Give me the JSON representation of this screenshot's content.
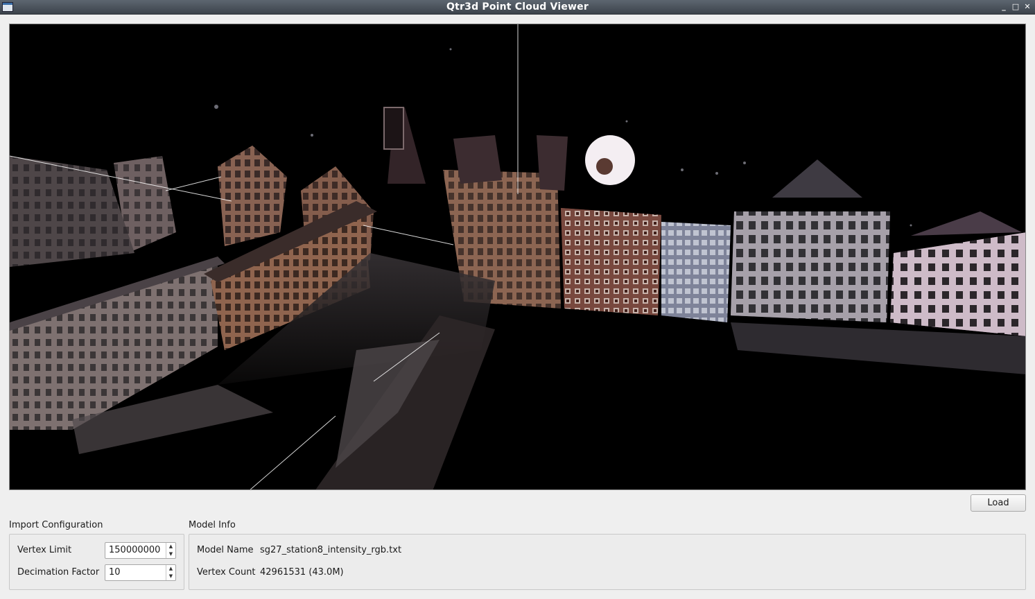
{
  "window": {
    "title": "Qtr3d Point Cloud Viewer",
    "controls": {
      "minimize": "_",
      "maximize": "□",
      "close": "✕"
    }
  },
  "viewport": {
    "background": "#000000"
  },
  "toolbar": {
    "load_label": "Load"
  },
  "import_config": {
    "title": "Import Configuration",
    "vertex_limit_label": "Vertex Limit",
    "vertex_limit_value": "150000000",
    "decimation_factor_label": "Decimation Factor",
    "decimation_factor_value": "10"
  },
  "model_info": {
    "title": "Model Info",
    "model_name_label": "Model Name",
    "model_name_value": "sg27_station8_intensity_rgb.txt",
    "vertex_count_label": "Vertex Count",
    "vertex_count_value": "42961531 (43.0M)"
  }
}
